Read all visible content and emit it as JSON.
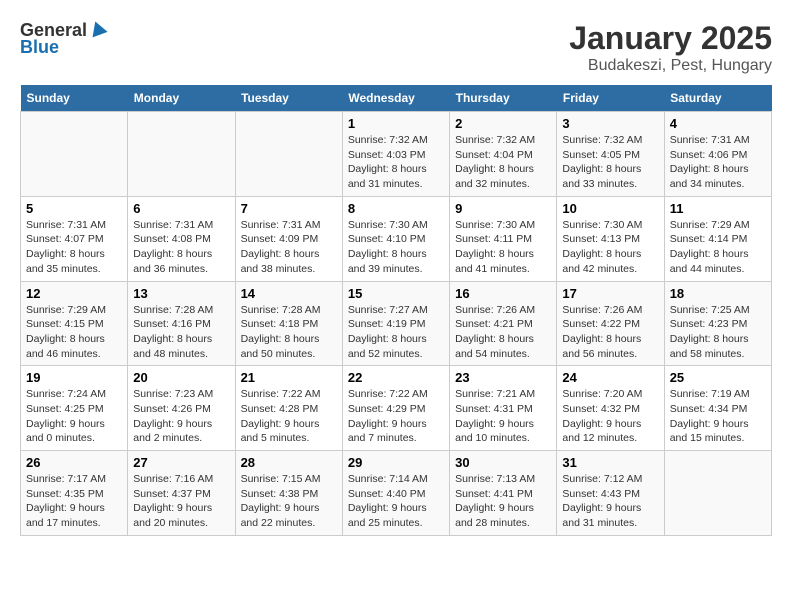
{
  "header": {
    "logo_general": "General",
    "logo_blue": "Blue",
    "title": "January 2025",
    "subtitle": "Budakeszi, Pest, Hungary"
  },
  "days_of_week": [
    "Sunday",
    "Monday",
    "Tuesday",
    "Wednesday",
    "Thursday",
    "Friday",
    "Saturday"
  ],
  "weeks": [
    [
      {
        "day": "",
        "info": ""
      },
      {
        "day": "",
        "info": ""
      },
      {
        "day": "",
        "info": ""
      },
      {
        "day": "1",
        "info": "Sunrise: 7:32 AM\nSunset: 4:03 PM\nDaylight: 8 hours and 31 minutes."
      },
      {
        "day": "2",
        "info": "Sunrise: 7:32 AM\nSunset: 4:04 PM\nDaylight: 8 hours and 32 minutes."
      },
      {
        "day": "3",
        "info": "Sunrise: 7:32 AM\nSunset: 4:05 PM\nDaylight: 8 hours and 33 minutes."
      },
      {
        "day": "4",
        "info": "Sunrise: 7:31 AM\nSunset: 4:06 PM\nDaylight: 8 hours and 34 minutes."
      }
    ],
    [
      {
        "day": "5",
        "info": "Sunrise: 7:31 AM\nSunset: 4:07 PM\nDaylight: 8 hours and 35 minutes."
      },
      {
        "day": "6",
        "info": "Sunrise: 7:31 AM\nSunset: 4:08 PM\nDaylight: 8 hours and 36 minutes."
      },
      {
        "day": "7",
        "info": "Sunrise: 7:31 AM\nSunset: 4:09 PM\nDaylight: 8 hours and 38 minutes."
      },
      {
        "day": "8",
        "info": "Sunrise: 7:30 AM\nSunset: 4:10 PM\nDaylight: 8 hours and 39 minutes."
      },
      {
        "day": "9",
        "info": "Sunrise: 7:30 AM\nSunset: 4:11 PM\nDaylight: 8 hours and 41 minutes."
      },
      {
        "day": "10",
        "info": "Sunrise: 7:30 AM\nSunset: 4:13 PM\nDaylight: 8 hours and 42 minutes."
      },
      {
        "day": "11",
        "info": "Sunrise: 7:29 AM\nSunset: 4:14 PM\nDaylight: 8 hours and 44 minutes."
      }
    ],
    [
      {
        "day": "12",
        "info": "Sunrise: 7:29 AM\nSunset: 4:15 PM\nDaylight: 8 hours and 46 minutes."
      },
      {
        "day": "13",
        "info": "Sunrise: 7:28 AM\nSunset: 4:16 PM\nDaylight: 8 hours and 48 minutes."
      },
      {
        "day": "14",
        "info": "Sunrise: 7:28 AM\nSunset: 4:18 PM\nDaylight: 8 hours and 50 minutes."
      },
      {
        "day": "15",
        "info": "Sunrise: 7:27 AM\nSunset: 4:19 PM\nDaylight: 8 hours and 52 minutes."
      },
      {
        "day": "16",
        "info": "Sunrise: 7:26 AM\nSunset: 4:21 PM\nDaylight: 8 hours and 54 minutes."
      },
      {
        "day": "17",
        "info": "Sunrise: 7:26 AM\nSunset: 4:22 PM\nDaylight: 8 hours and 56 minutes."
      },
      {
        "day": "18",
        "info": "Sunrise: 7:25 AM\nSunset: 4:23 PM\nDaylight: 8 hours and 58 minutes."
      }
    ],
    [
      {
        "day": "19",
        "info": "Sunrise: 7:24 AM\nSunset: 4:25 PM\nDaylight: 9 hours and 0 minutes."
      },
      {
        "day": "20",
        "info": "Sunrise: 7:23 AM\nSunset: 4:26 PM\nDaylight: 9 hours and 2 minutes."
      },
      {
        "day": "21",
        "info": "Sunrise: 7:22 AM\nSunset: 4:28 PM\nDaylight: 9 hours and 5 minutes."
      },
      {
        "day": "22",
        "info": "Sunrise: 7:22 AM\nSunset: 4:29 PM\nDaylight: 9 hours and 7 minutes."
      },
      {
        "day": "23",
        "info": "Sunrise: 7:21 AM\nSunset: 4:31 PM\nDaylight: 9 hours and 10 minutes."
      },
      {
        "day": "24",
        "info": "Sunrise: 7:20 AM\nSunset: 4:32 PM\nDaylight: 9 hours and 12 minutes."
      },
      {
        "day": "25",
        "info": "Sunrise: 7:19 AM\nSunset: 4:34 PM\nDaylight: 9 hours and 15 minutes."
      }
    ],
    [
      {
        "day": "26",
        "info": "Sunrise: 7:17 AM\nSunset: 4:35 PM\nDaylight: 9 hours and 17 minutes."
      },
      {
        "day": "27",
        "info": "Sunrise: 7:16 AM\nSunset: 4:37 PM\nDaylight: 9 hours and 20 minutes."
      },
      {
        "day": "28",
        "info": "Sunrise: 7:15 AM\nSunset: 4:38 PM\nDaylight: 9 hours and 22 minutes."
      },
      {
        "day": "29",
        "info": "Sunrise: 7:14 AM\nSunset: 4:40 PM\nDaylight: 9 hours and 25 minutes."
      },
      {
        "day": "30",
        "info": "Sunrise: 7:13 AM\nSunset: 4:41 PM\nDaylight: 9 hours and 28 minutes."
      },
      {
        "day": "31",
        "info": "Sunrise: 7:12 AM\nSunset: 4:43 PM\nDaylight: 9 hours and 31 minutes."
      },
      {
        "day": "",
        "info": ""
      }
    ]
  ]
}
